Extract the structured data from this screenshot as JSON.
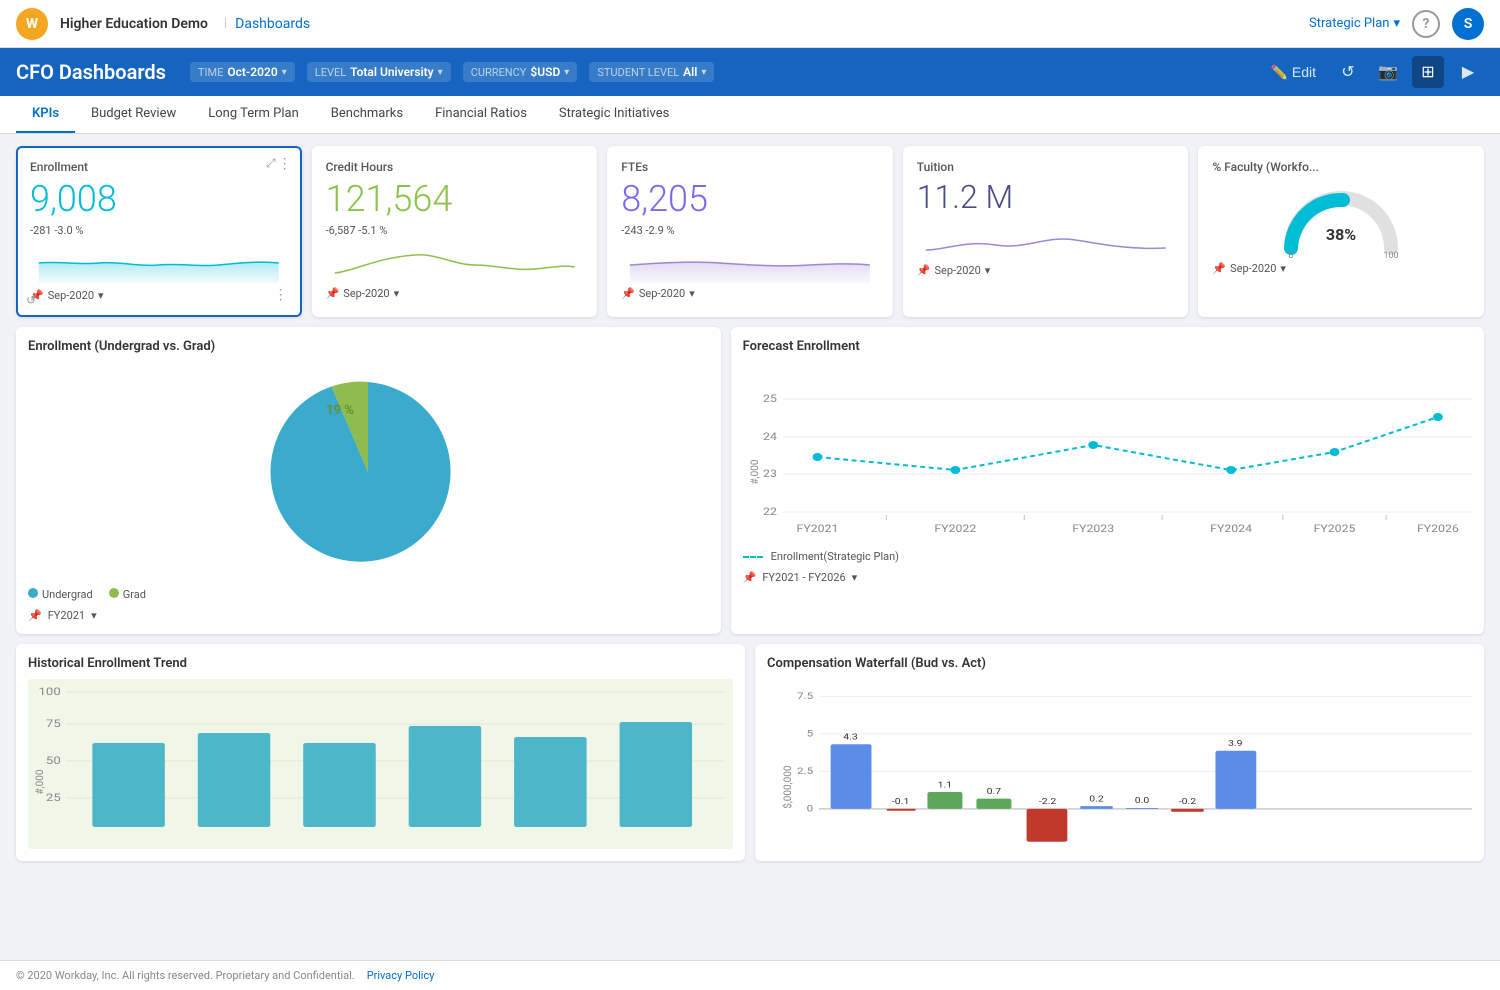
{
  "topnav": {
    "logo": "W",
    "app": "Higher Education Demo",
    "section": "Dashboards",
    "plan": "Strategic Plan",
    "help": "?",
    "user": "S"
  },
  "header": {
    "title": "CFO Dashboards",
    "filters": {
      "time": {
        "label": "TIME",
        "value": "Oct-2020"
      },
      "level": {
        "label": "LEVEL",
        "value": "Total University"
      },
      "currency": {
        "label": "CURRENCY",
        "value": "$USD"
      },
      "student": {
        "label": "STUDENT LEVEL",
        "value": "All"
      }
    },
    "actions": {
      "edit": "Edit",
      "refresh": "↺",
      "camera": "📷",
      "grid": "⊞",
      "video": "▶"
    }
  },
  "tabs": [
    {
      "id": "kpis",
      "label": "KPIs",
      "active": true
    },
    {
      "id": "budget-review",
      "label": "Budget Review",
      "active": false
    },
    {
      "id": "long-term-plan",
      "label": "Long Term Plan",
      "active": false
    },
    {
      "id": "benchmarks",
      "label": "Benchmarks",
      "active": false
    },
    {
      "id": "financial-ratios",
      "label": "Financial Ratios",
      "active": false
    },
    {
      "id": "strategic-initiatives",
      "label": "Strategic Initiatives",
      "active": false
    }
  ],
  "kpis": [
    {
      "id": "enrollment",
      "title": "Enrollment",
      "value": "9,008",
      "color": "teal",
      "delta": "-281  -3.0 %",
      "date": "Sep-2020",
      "selected": true
    },
    {
      "id": "credit-hours",
      "title": "Credit Hours",
      "value": "121,564",
      "color": "green",
      "delta": "-6,587  -5.1 %",
      "date": "Sep-2020",
      "selected": false
    },
    {
      "id": "ftes",
      "title": "FTEs",
      "value": "8,205",
      "color": "purple",
      "delta": "-243  -2.9 %",
      "date": "Sep-2020",
      "selected": false
    },
    {
      "id": "tuition",
      "title": "Tuition",
      "value": "11.2 M",
      "color": "dark-purple",
      "delta": "",
      "date": "Sep-2020",
      "selected": false
    },
    {
      "id": "faculty",
      "title": "% Faculty (Workfo...",
      "value": "38%",
      "color": "teal",
      "delta": "",
      "date": "Sep-2020",
      "gauge": true,
      "gauge_value": 38,
      "selected": false
    }
  ],
  "pie_chart": {
    "title": "Enrollment (Undergrad vs. Grad)",
    "segments": [
      {
        "label": "Undergrad",
        "pct": 81,
        "color": "#3aabcc"
      },
      {
        "label": "Grad",
        "pct": 19,
        "color": "#8fbc4e"
      }
    ],
    "date": "FY2021"
  },
  "forecast_chart": {
    "title": "Forecast Enrollment",
    "legend": "Enrollment(Strategic Plan)",
    "date": "FY2021 - FY2026",
    "x_labels": [
      "FY2021",
      "FY2022",
      "FY2023",
      "FY2024",
      "FY2025",
      "FY2026"
    ],
    "y_labels": [
      "22",
      "23",
      "24",
      "25"
    ],
    "y_axis_label": "#,000",
    "data": [
      23.2,
      22.9,
      23.5,
      22.9,
      23.4,
      24.3
    ]
  },
  "hist_chart": {
    "title": "Historical Enrollment Trend",
    "y_labels": [
      "25",
      "50",
      "75",
      "100"
    ],
    "y_axis_label": "#,000",
    "bars": [
      65,
      70,
      65,
      72,
      68,
      75
    ]
  },
  "waterfall_chart": {
    "title": "Compensation Waterfall (Bud vs. Act)",
    "y_labels": [
      "0",
      "2.5",
      "5",
      "7.5"
    ],
    "y_axis_label": "$,000,000",
    "labels": [
      "4.3",
      "-0.1",
      "1.1",
      "0.7",
      "-2.2",
      "0.2",
      "0.0",
      "-0.2",
      "3.9"
    ],
    "bar_colors": [
      "#5b8de8",
      "#5b8de8",
      "#5b8de8",
      "#5ba85b",
      "#c0392b",
      "#5b8de8",
      "#5b8de8",
      "#c0392b",
      "#5b8de8"
    ]
  },
  "footer": {
    "copyright": "© 2020 Workday, Inc. All rights reserved. Proprietary and Confidential.",
    "privacy": "Privacy Policy"
  }
}
